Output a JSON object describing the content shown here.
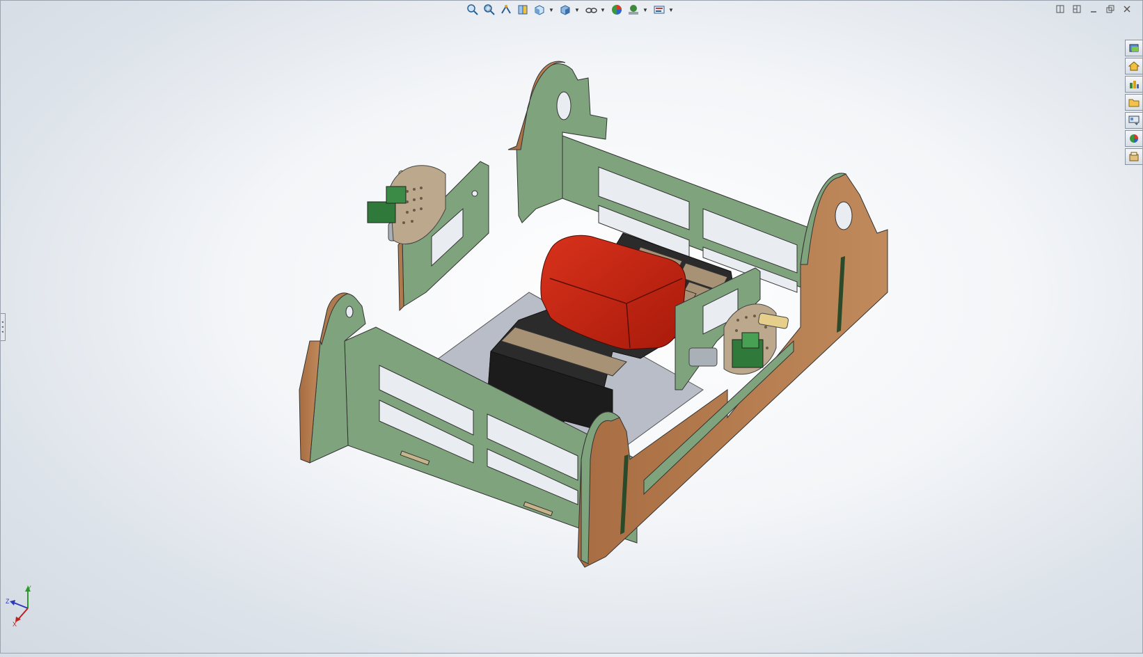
{
  "hud_toolbar": {
    "buttons": [
      {
        "icon": "zoom-to-fit-icon"
      },
      {
        "icon": "zoom-to-area-icon"
      },
      {
        "icon": "previous-view-icon"
      },
      {
        "icon": "section-view-icon"
      },
      {
        "icon": "view-orientation-icon",
        "dropdown": true
      },
      {
        "icon": "display-style-icon",
        "dropdown": true
      },
      {
        "icon": "hide-show-items-icon",
        "dropdown": true
      },
      {
        "icon": "edit-appearance-icon"
      },
      {
        "icon": "apply-scene-icon",
        "dropdown": true
      },
      {
        "icon": "view-settings-icon",
        "dropdown": true
      }
    ]
  },
  "window_controls": [
    "tile-horizontal-icon",
    "tile-vertical-icon",
    "minimize-icon",
    "restore-icon",
    "close-icon"
  ],
  "task_pane_tabs": [
    "solidworks-resources-icon",
    "home-icon",
    "design-library-icon",
    "file-explorer-icon",
    "view-palette-icon",
    "appearances-scenes-icon",
    "custom-properties-icon"
  ],
  "triad": {
    "x_label": "X",
    "y_label": "Y",
    "z_label": "Z"
  },
  "colors": {
    "panel_green": "#7fa37c",
    "wood_edge": "#b07a4f",
    "red_component": "#c42210",
    "black_component": "#2a2a2a",
    "tan_label": "#a89276",
    "connector_green": "#2f7a3a",
    "plate_gray": "#b8bcc6"
  }
}
